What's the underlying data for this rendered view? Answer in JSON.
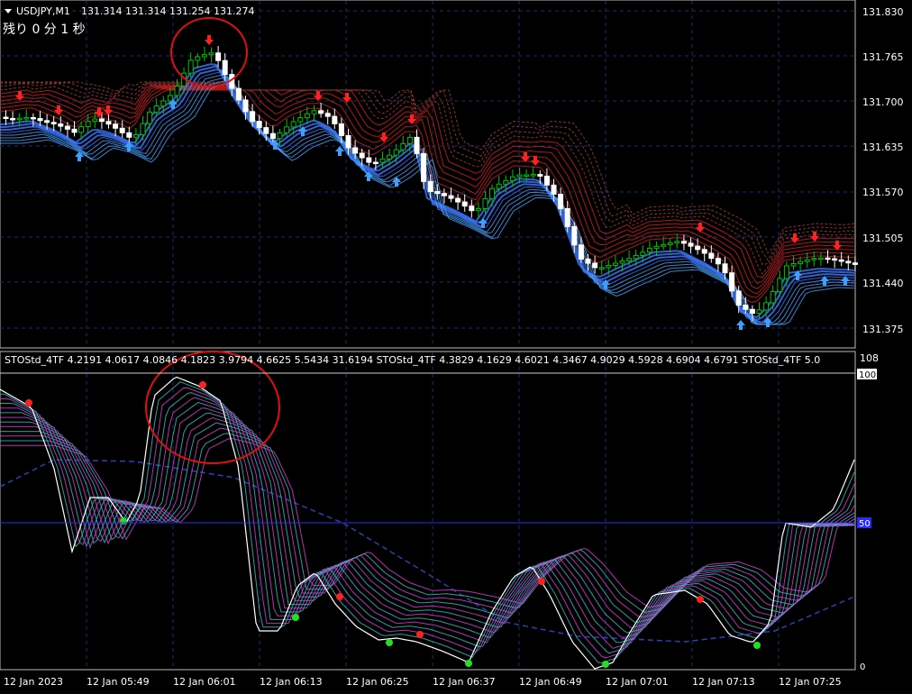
{
  "header": {
    "symbol_label": "USDJPY,M1",
    "ohlc": "131.314 131.314 131.254 131.274",
    "countdown": "残り 0 分 1 秒"
  },
  "price_axis": {
    "ticks": [
      "131.830",
      "131.765",
      "131.700",
      "131.635",
      "131.570",
      "131.505",
      "131.440",
      "131.375"
    ]
  },
  "indicator": {
    "label": "STOStd_4TF 4.2191 4.0617 4.0846 4.1823 3.9794 4.6625 5.5434 31.6194  STOStd_4TF 4.3829 4.1629 4.6021 4.3467 4.9029 4.5928 4.6904 4.6791  STOStd_4TF 5.0",
    "axis_labels": {
      "max": "108",
      "upper": "100",
      "mid": "50",
      "low": "0"
    }
  },
  "time_axis": {
    "labels": [
      "12 Jan 2023",
      "12 Jan 05:49",
      "12 Jan 06:01",
      "12 Jan 06:13",
      "12 Jan 06:25",
      "12 Jan 06:37",
      "12 Jan 06:49",
      "12 Jan 07:01",
      "12 Jan 07:13",
      "12 Jan 07:25"
    ]
  },
  "colors": {
    "background": "#000000",
    "grid": "#1a2b6b",
    "bull_candle": "#00c000",
    "bear_candle": "#ffffff",
    "red_ribbon": "#c81e1e",
    "blue_ribbon": "#3d79ff",
    "arrow_up": "#3f9fff",
    "arrow_down": "#ff2020",
    "stoch_main": "#ffffff",
    "stoch_magenta": "#d23cd2",
    "stoch_teal": "#35b8b8",
    "level_line": "#2a2aff",
    "highlight_circle": "#e01010"
  }
}
